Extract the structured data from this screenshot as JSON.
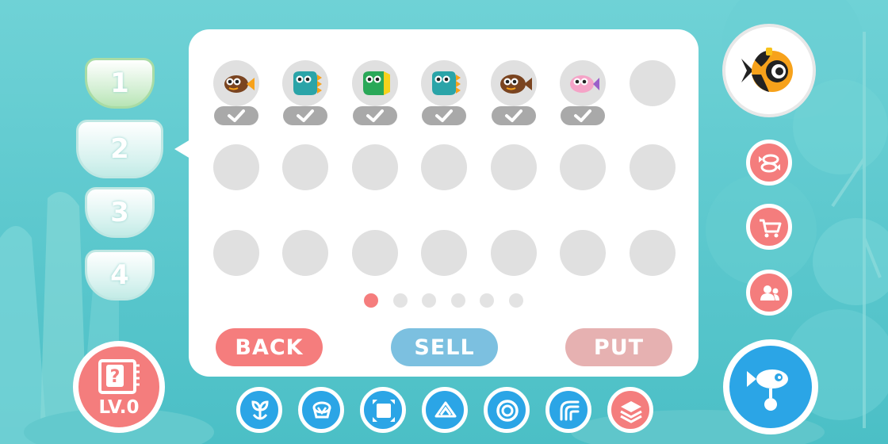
{
  "colors": {
    "background": "#58c7cc",
    "panel": "#ffffff",
    "slot_empty": "#e0e0e0",
    "check_badge": "#a9a9a9",
    "accent_red": "#f47d7d",
    "accent_blue": "#2ba5e6",
    "sell_button": "#7cc0e0",
    "put_button": "#e6b1b1",
    "back_button": "#f57d7d"
  },
  "tanks": [
    {
      "label": "1",
      "state": "active"
    },
    {
      "label": "2",
      "state": "selected"
    },
    {
      "label": "3",
      "state": "normal"
    },
    {
      "label": "4",
      "state": "normal"
    }
  ],
  "grid": {
    "slots": [
      {
        "fish": "orange-brown-fish-icon",
        "owned": true
      },
      {
        "fish": "teal-fish-icon",
        "owned": true
      },
      {
        "fish": "green-yellow-fish-icon",
        "owned": true
      },
      {
        "fish": "teal-fish-icon",
        "owned": true
      },
      {
        "fish": "brown-fish-icon",
        "owned": true
      },
      {
        "fish": "pink-fish-icon",
        "owned": true
      },
      {
        "fish": null,
        "owned": false
      },
      {
        "fish": null,
        "owned": false
      },
      {
        "fish": null,
        "owned": false
      },
      {
        "fish": null,
        "owned": false
      },
      {
        "fish": null,
        "owned": false
      },
      {
        "fish": null,
        "owned": false
      },
      {
        "fish": null,
        "owned": false
      },
      {
        "fish": null,
        "owned": false
      },
      {
        "fish": null,
        "owned": false
      },
      {
        "fish": null,
        "owned": false
      },
      {
        "fish": null,
        "owned": false
      },
      {
        "fish": null,
        "owned": false
      },
      {
        "fish": null,
        "owned": false
      },
      {
        "fish": null,
        "owned": false
      },
      {
        "fish": null,
        "owned": false
      }
    ]
  },
  "pagination": {
    "page_count": 6,
    "current_page": 1
  },
  "actions": {
    "back_label": "BACK",
    "sell_label": "SELL",
    "put_label": "PUT"
  },
  "level": {
    "label": "LV.0",
    "icon": "mystery-book-icon"
  },
  "avatar": {
    "icon": "yellow-black-fish-avatar-icon"
  },
  "side_menu": [
    {
      "name": "fish-collection-icon"
    },
    {
      "name": "shopping-cart-icon"
    },
    {
      "name": "friends-icon"
    }
  ],
  "bottom_toolbar": [
    {
      "name": "plant-icon"
    },
    {
      "name": "decoration-icon"
    },
    {
      "name": "expand-icon"
    },
    {
      "name": "upgrade-arrow-icon"
    },
    {
      "name": "ring-target-icon"
    },
    {
      "name": "wave-icon"
    },
    {
      "name": "layers-icon",
      "active": true
    }
  ],
  "main_button": {
    "icon": "diver-fish-icon"
  }
}
